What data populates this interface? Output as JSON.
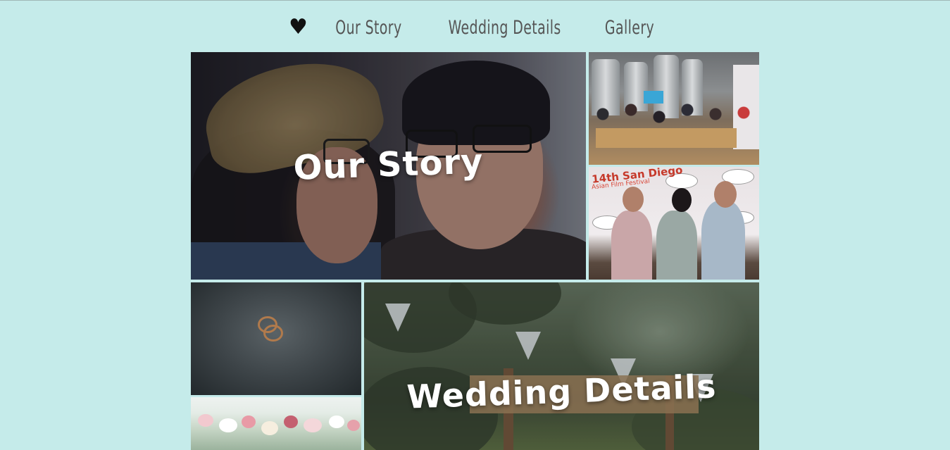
{
  "nav": {
    "home_icon": "♥",
    "items": [
      "Our Story",
      "Wedding Details",
      "Gallery"
    ]
  },
  "tiles": {
    "our_story": {
      "label": "Our Story"
    },
    "wedding_details": {
      "label": "Wedding Details"
    },
    "film_festival": {
      "logo_line1": "14th San Diego",
      "logo_line2": "Asian Film Festival"
    }
  },
  "colors": {
    "background": "#c5ebea",
    "nav_text": "#555555",
    "tile_label": "#ffffff"
  }
}
